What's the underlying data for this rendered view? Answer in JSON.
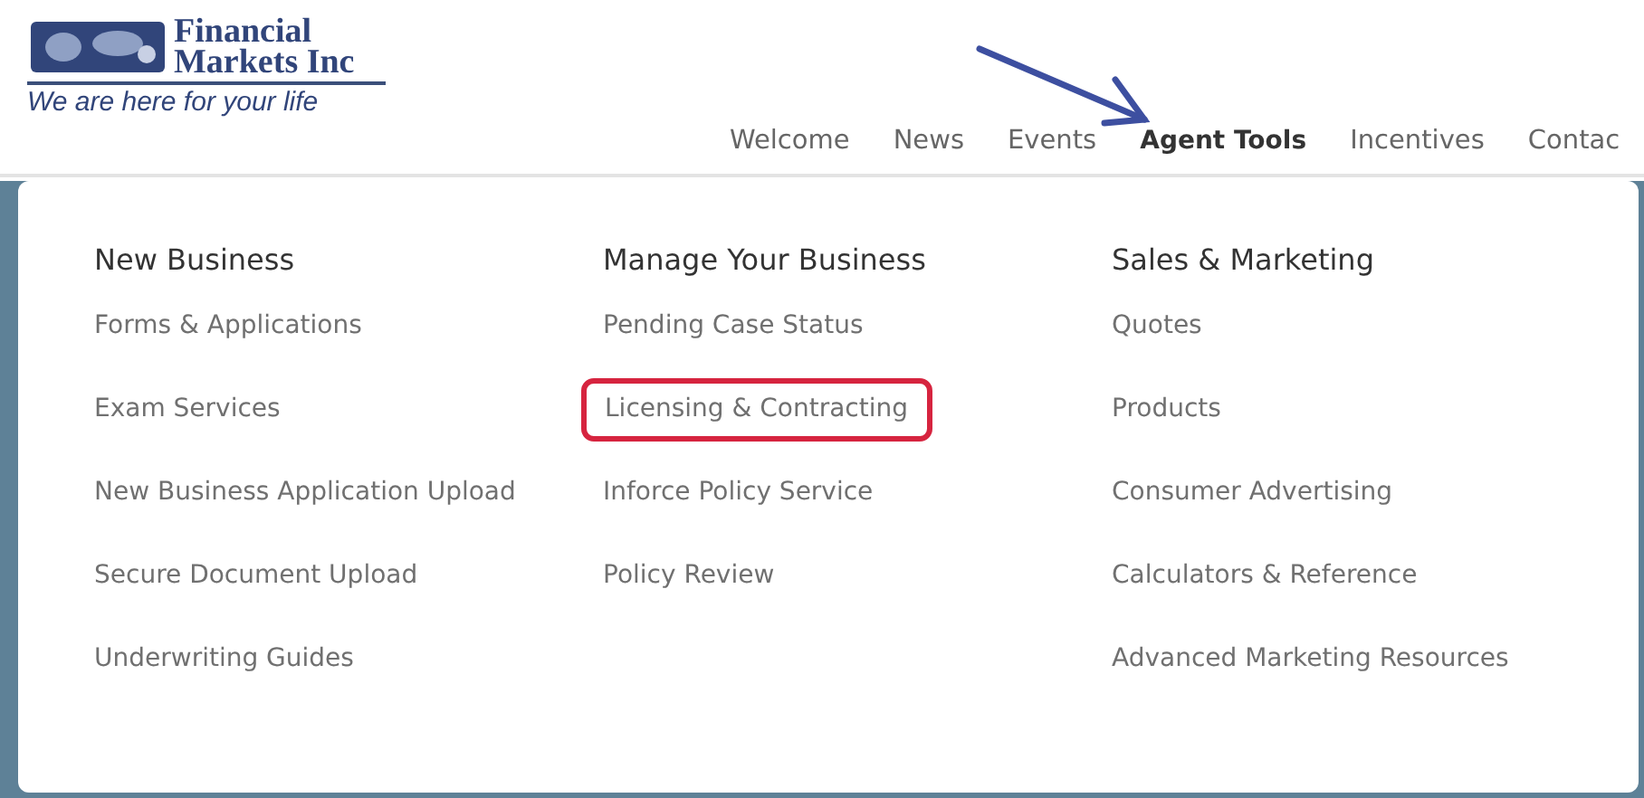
{
  "logo": {
    "name_line_1": "Financial",
    "name_line_2": "Markets Inc",
    "tagline": "We are here for your life"
  },
  "nav": [
    {
      "label": "Welcome",
      "selected": false
    },
    {
      "label": "News",
      "selected": false
    },
    {
      "label": "Events",
      "selected": false
    },
    {
      "label": "Agent Tools",
      "selected": true
    },
    {
      "label": "Incentives",
      "selected": false
    },
    {
      "label": "Contac",
      "selected": false
    }
  ],
  "annotation_arrow": {
    "kind": "arrow"
  },
  "menu": {
    "columns": [
      {
        "heading": "New Business",
        "items": [
          {
            "label": "Forms & Applications",
            "highlighted": false
          },
          {
            "label": "Exam Services",
            "highlighted": false
          },
          {
            "label": "New Business Application Upload",
            "highlighted": false
          },
          {
            "label": "Secure Document Upload",
            "highlighted": false
          },
          {
            "label": "Underwriting Guides",
            "highlighted": false
          }
        ]
      },
      {
        "heading": "Manage Your Business",
        "items": [
          {
            "label": "Pending Case Status",
            "highlighted": false
          },
          {
            "label": "Licensing & Contracting",
            "highlighted": true
          },
          {
            "label": "Inforce Policy Service",
            "highlighted": false
          },
          {
            "label": "Policy Review",
            "highlighted": false
          }
        ]
      },
      {
        "heading": "Sales & Marketing",
        "items": [
          {
            "label": "Quotes",
            "highlighted": false
          },
          {
            "label": "Products",
            "highlighted": false
          },
          {
            "label": "Consumer Advertising",
            "highlighted": false
          },
          {
            "label": "Calculators & Reference",
            "highlighted": false
          },
          {
            "label": "Advanced Marketing Resources",
            "highlighted": false
          }
        ]
      }
    ]
  }
}
